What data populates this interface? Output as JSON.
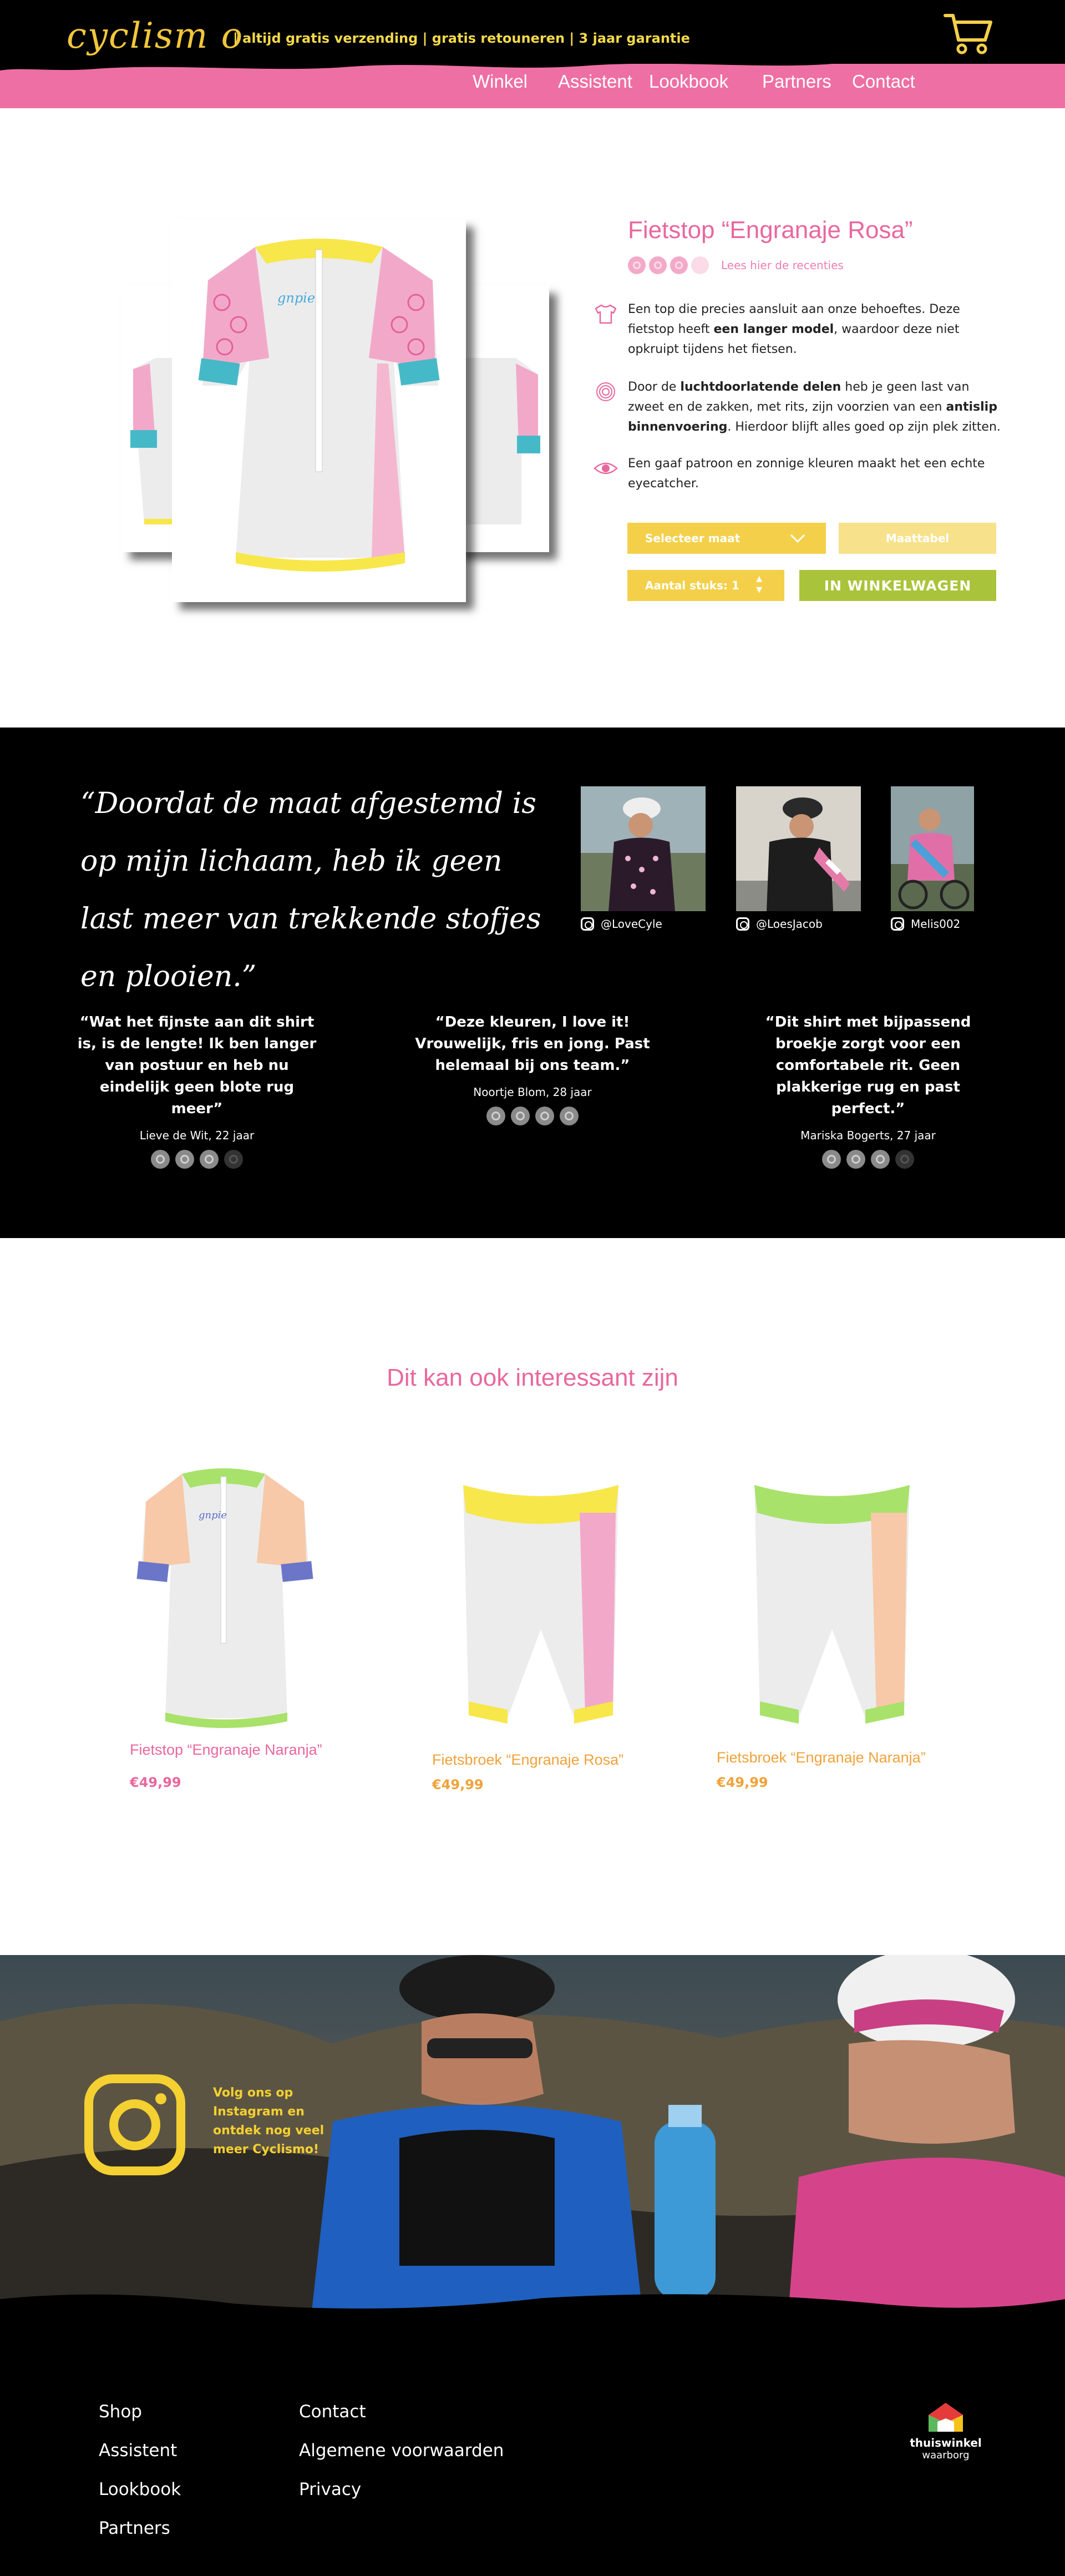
{
  "header": {
    "logo_text": "cyclism o",
    "tagline": "| altijd gratis verzending | gratis retouneren | 3 jaar garantie",
    "nav": [
      "Winkel",
      "Assistent",
      "Lookbook",
      "Partners",
      "Contact"
    ]
  },
  "product": {
    "title": "Fietstop “Engranaje Rosa”",
    "rating": 3,
    "rating_max": 4,
    "reviews_link": "Lees hier de recenties",
    "features": [
      {
        "icon": "shirt-icon",
        "before": "Een top die precies aansluit aan onze behoeftes. Deze fietstop heeft ",
        "bold": "een langer model",
        "after": ", waardoor deze niet opkruipt tijdens het fietsen."
      },
      {
        "icon": "pattern-icon",
        "before": "Door de ",
        "bold": "luchtdoorlatende delen",
        "after": " heb je geen last van zweet en de zakken, met rits, zijn voorzien van een ",
        "bold2": "antislip binnenvoering",
        "after2": ". Hierdoor blijft alles goed op zijn plek zitten."
      },
      {
        "icon": "eye-icon",
        "before": "Een gaaf patroon en zonnige kleuren maakt het een echte eyecatcher.",
        "bold": "",
        "after": ""
      }
    ],
    "size_select": "Selecteer maat",
    "size_chart": "Maattabel",
    "quantity_label": "Aantal stuks: 1",
    "add_to_cart": "IN WINKELWAGEN"
  },
  "testimonials": {
    "quote": "“Doordat de maat afgestemd is op mijn lichaam, heb ik geen last meer van trekkende stofjes en plooien.”",
    "instagram": [
      {
        "handle": "@LoveCyle"
      },
      {
        "handle": "@LoesJacob"
      },
      {
        "handle": "Melis002"
      }
    ],
    "reviews": [
      {
        "text": "“Wat het fijnste aan dit shirt is, is de lengte! Ik ben langer van postuur en heb nu eindelijk geen blote rug meer”",
        "meta": "Lieve de Wit, 22 jaar",
        "rating": 3
      },
      {
        "text": "“Deze kleuren, I love it! Vrouwelijk, fris en jong. Past helemaal bij ons team.”",
        "meta": "Noortje Blom, 28 jaar",
        "rating": 4
      },
      {
        "text": "“Dit shirt met bijpassend broekje zorgt voor een comfortabele rit. Geen plakkerige rug en past perfect.”",
        "meta": "Mariska Bogerts, 27 jaar",
        "rating": 3
      }
    ]
  },
  "related": {
    "title": "Dit kan ook interessant zijn",
    "items": [
      {
        "name": "Fietstop “Engranaje Naranja”",
        "price": "€49,99"
      },
      {
        "name": "Fietsbroek “Engranaje Rosa”",
        "price": "€49,99"
      },
      {
        "name": "Fietsbroek “Engranaje Naranja”",
        "price": "€49,99"
      }
    ]
  },
  "banner": {
    "text": "Volg ons op Instagram en ontdek nog veel meer Cyclismo!"
  },
  "footer": {
    "col1": [
      "Shop",
      "Assistent",
      "Lookbook",
      "Partners"
    ],
    "col2": [
      "Contact",
      "Algemene voorwaarden",
      "Privacy"
    ],
    "badge_line1": "thuiswinkel",
    "badge_line2": "waarborg"
  },
  "colors": {
    "pink": "#ee6fa3",
    "yellow": "#f4d04a",
    "green": "#a9c43a",
    "orange": "#f0a23a"
  }
}
